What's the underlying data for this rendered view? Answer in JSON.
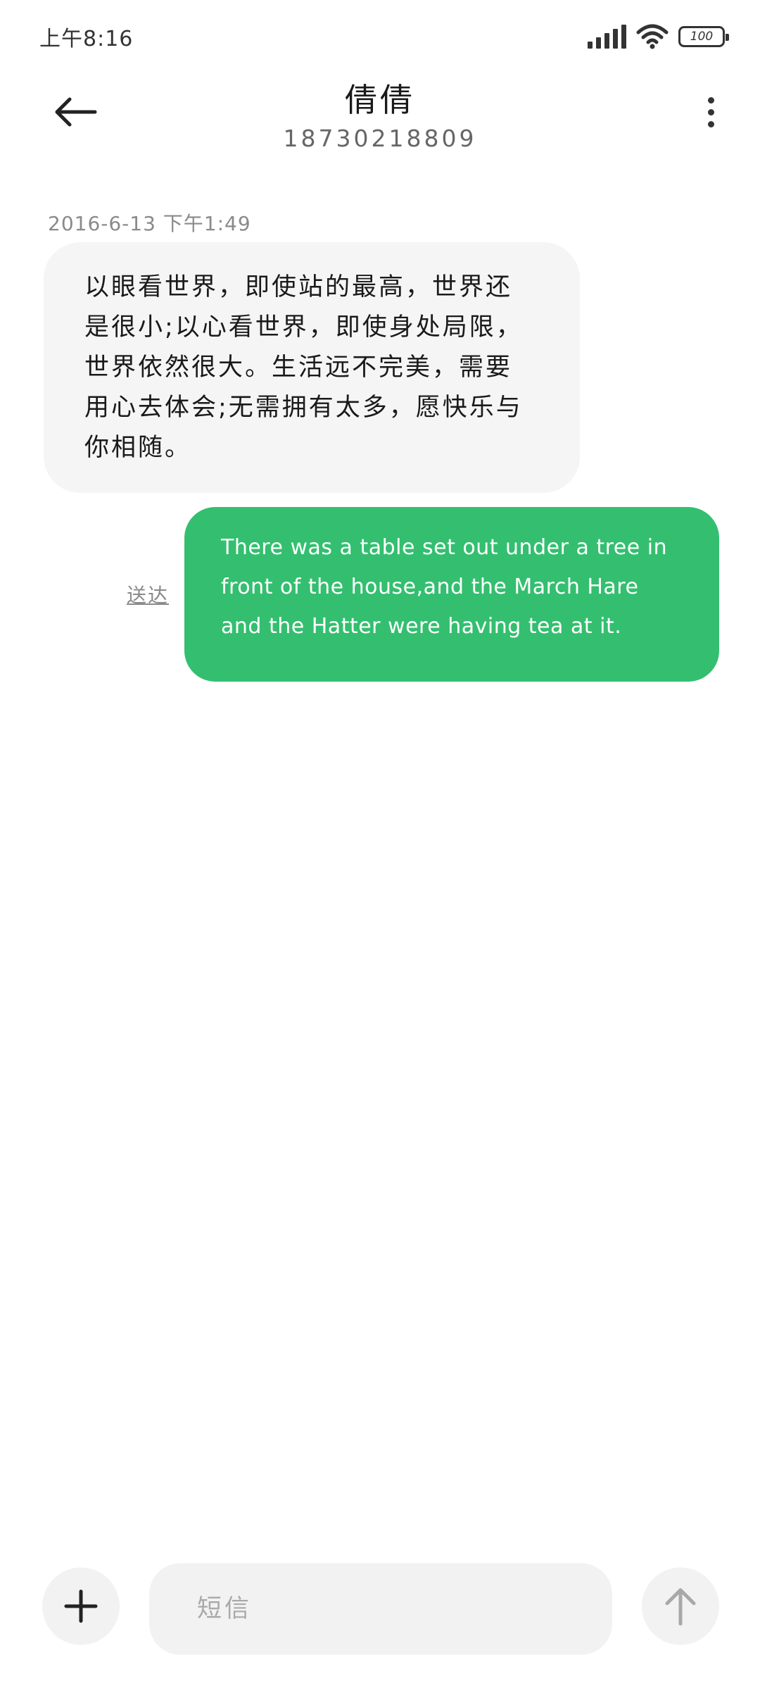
{
  "status_bar": {
    "time": "上午8:16",
    "battery": "100"
  },
  "header": {
    "contact_name": "倩倩",
    "contact_number": "18730218809"
  },
  "conversation": {
    "timestamp": "2016-6-13 下午1:49",
    "incoming_message": "以眼看世界，即使站的最高，世界还是很小;以心看世界，即使身处局限，世界依然很大。生活远不完美，需要用心去体会;无需拥有太多，愿快乐与你相随。",
    "outgoing_message": "There was a table set out under a tree in front of the house,and the March Hare and the Hatter were having tea at it.",
    "delivery_status": "送达"
  },
  "composer": {
    "placeholder": "短信"
  },
  "colors": {
    "outgoing_bubble": "#33bf6f",
    "incoming_bubble": "#f5f5f5",
    "composer_bg": "#f2f2f2"
  },
  "icons": {
    "back": "arrow-left-icon",
    "more": "more-vertical-icon",
    "attach": "plus-icon",
    "send": "arrow-up-icon",
    "signal": "signal-icon",
    "wifi": "wifi-icon",
    "battery": "battery-icon"
  }
}
